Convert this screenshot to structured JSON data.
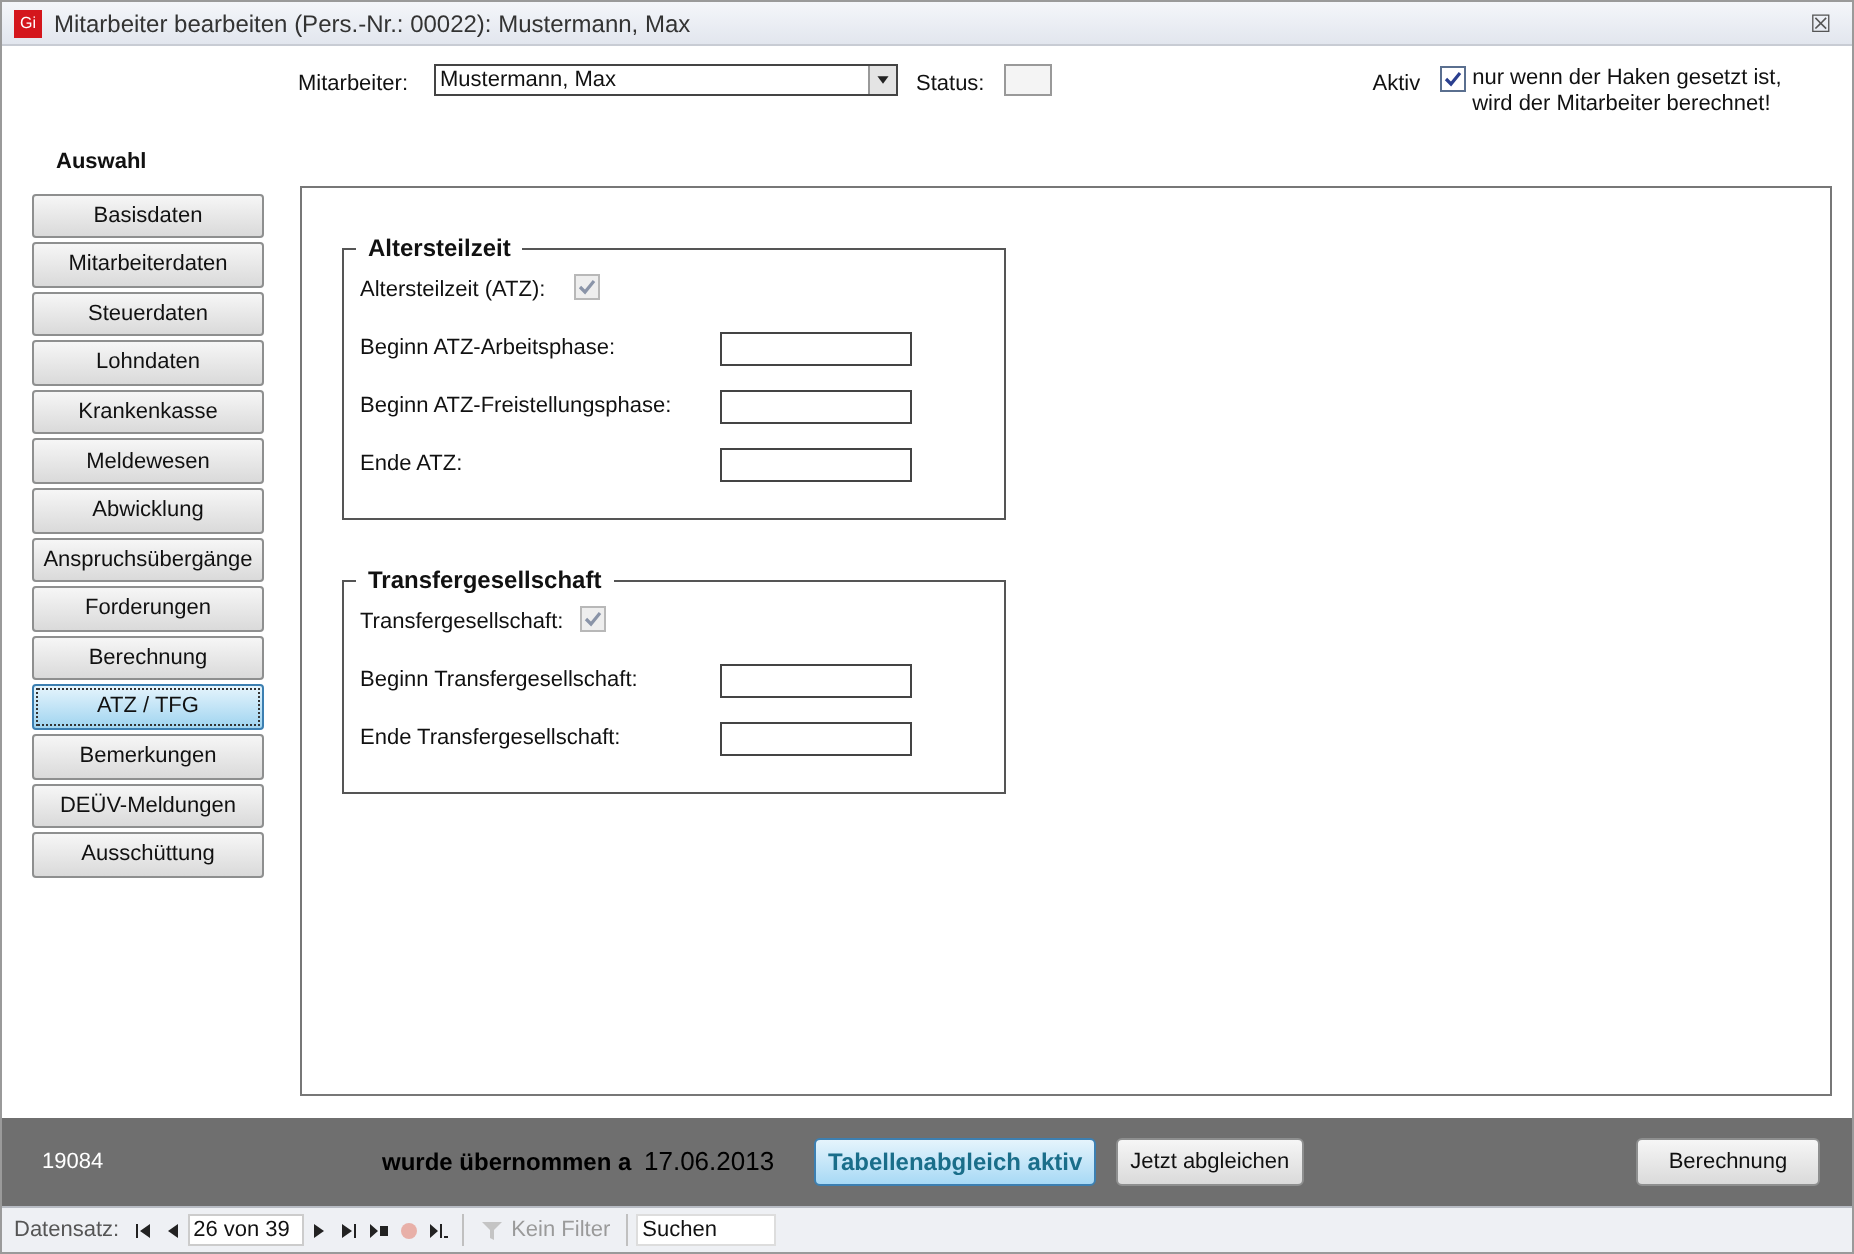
{
  "window": {
    "title": "Mitarbeiter bearbeiten (Pers.-Nr.: 00022): Mustermann, Max",
    "logo": "Gi",
    "close": "☒"
  },
  "header": {
    "employee_label": "Mitarbeiter:",
    "employee_value": "Mustermann, Max",
    "status_label": "Status:",
    "active_label": "Aktiv",
    "active_checked": true,
    "active_hint": "nur wenn der Haken gesetzt ist,\nwird der Mitarbeiter berechnet!"
  },
  "sidebar": {
    "title": "Auswahl",
    "items": [
      {
        "label": "Basisdaten",
        "selected": false
      },
      {
        "label": "Mitarbeiterdaten",
        "selected": false
      },
      {
        "label": "Steuerdaten",
        "selected": false
      },
      {
        "label": "Lohndaten",
        "selected": false
      },
      {
        "label": "Krankenkasse",
        "selected": false
      },
      {
        "label": "Meldewesen",
        "selected": false
      },
      {
        "label": "Abwicklung",
        "selected": false
      },
      {
        "label": "Anspruchsübergänge",
        "selected": false
      },
      {
        "label": "Forderungen",
        "selected": false
      },
      {
        "label": "Berechnung",
        "selected": false
      },
      {
        "label": "ATZ / TFG",
        "selected": true
      },
      {
        "label": "Bemerkungen",
        "selected": false
      },
      {
        "label": "DEÜV-Meldungen",
        "selected": false
      },
      {
        "label": "Ausschüttung",
        "selected": false
      }
    ]
  },
  "groups": [
    {
      "title": "Altersteilzeit",
      "rows": [
        {
          "kind": "checkbox",
          "label": "Altersteilzeit (ATZ):",
          "checked": true
        },
        {
          "kind": "field",
          "label": "Beginn ATZ-Arbeitsphase:"
        },
        {
          "kind": "field",
          "label": "Beginn ATZ-Freistellungsphase:"
        },
        {
          "kind": "field",
          "label": "Ende ATZ:"
        }
      ]
    },
    {
      "title": "Transfergesellschaft",
      "rows": [
        {
          "kind": "checkbox",
          "label": "Transfergesellschaft:",
          "checked": true
        },
        {
          "kind": "field",
          "label": "Beginn Transfergesellschaft:"
        },
        {
          "kind": "field",
          "label": "Ende Transfergesellschaft:"
        }
      ]
    }
  ],
  "footer": {
    "number": "19084",
    "taken_over": "wurde übernommen a",
    "date": "17.06.2013",
    "buttons": [
      {
        "label": "Tabellenabgleich aktiv",
        "selected": true
      },
      {
        "label": "Jetzt abgleichen",
        "selected": false
      }
    ],
    "calc_button": "Berechnung"
  },
  "navigation": {
    "label": "Datensatz:",
    "record": "26 von 39",
    "filter": "Kein Filter",
    "search": "Suchen"
  }
}
